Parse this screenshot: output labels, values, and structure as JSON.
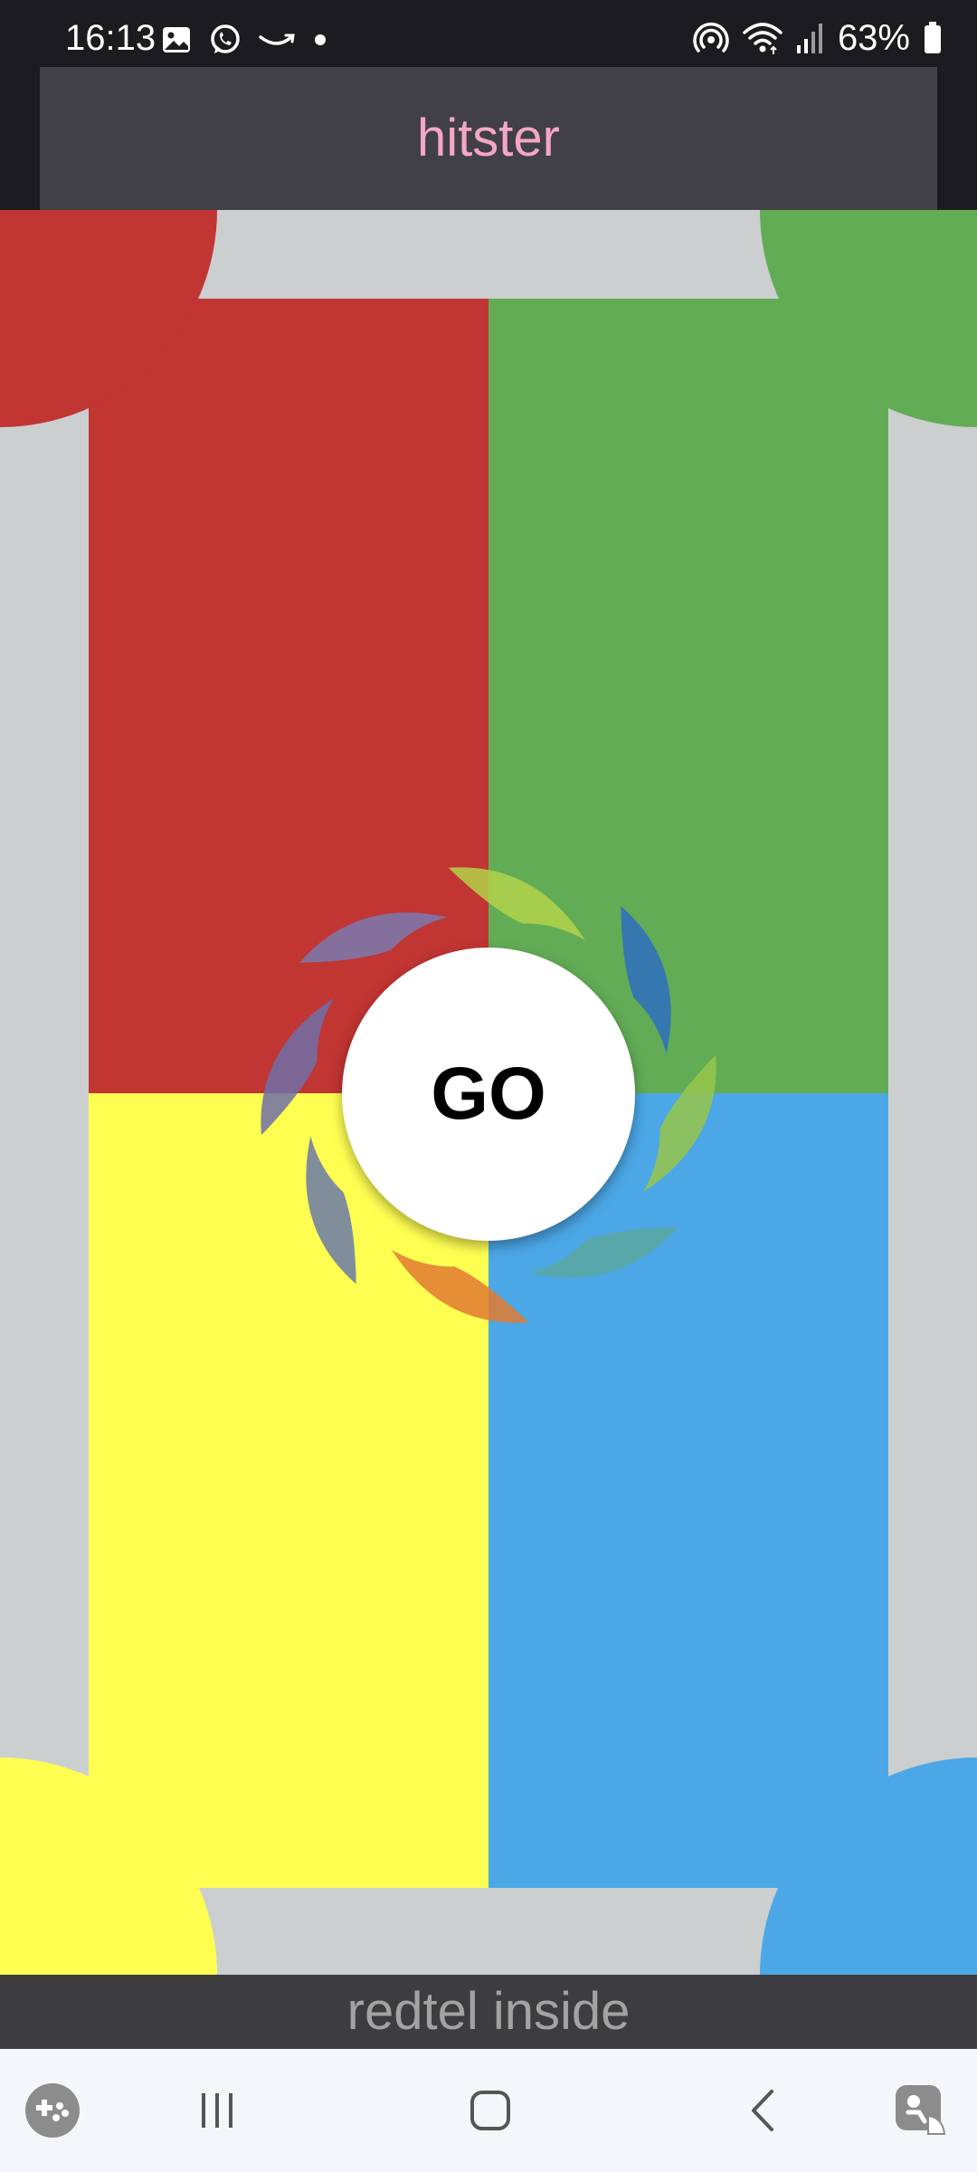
{
  "status_bar": {
    "time": "16:13",
    "battery_percent": "63%",
    "left_icons": [
      "gallery-icon",
      "whatsapp-icon",
      "amazon-icon",
      "dot-icon"
    ],
    "right_icons": [
      "hotspot-icon",
      "wifi-icon",
      "signal-icon",
      "battery-icon"
    ]
  },
  "app_bar": {
    "title": "hitster",
    "title_color": "#f4a7c4"
  },
  "board": {
    "colors": {
      "red": "#c13532",
      "green": "#62ac56",
      "yellow": "#ffff52",
      "blue": "#4ba7e6",
      "frame": "#cbcfd0"
    },
    "go_label": "GO"
  },
  "footer": {
    "text": "redtel inside"
  },
  "nav_bar": {
    "icons": [
      "game-launcher-icon",
      "recent-apps-icon",
      "home-icon",
      "back-icon",
      "accessibility-icon"
    ]
  }
}
